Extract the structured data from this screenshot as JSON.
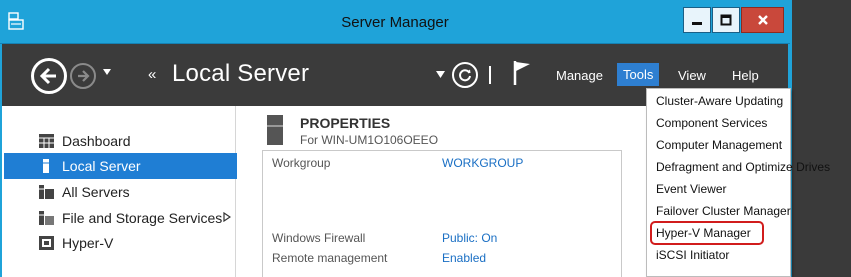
{
  "window": {
    "title": "Server Manager",
    "colors": {
      "accent": "#1fa3d9",
      "header": "#3b3b3b",
      "selection": "#1f7ed4",
      "link": "#1a6fc4",
      "highlight": "#d11c1c"
    }
  },
  "header": {
    "page_title": "Local Server",
    "menus": {
      "manage": "Manage",
      "tools": "Tools",
      "view": "View",
      "help": "Help"
    }
  },
  "sidebar": {
    "items": [
      {
        "label": "Dashboard",
        "icon": "dashboard-icon",
        "active": false
      },
      {
        "label": "Local Server",
        "icon": "local-server-icon",
        "active": true
      },
      {
        "label": "All Servers",
        "icon": "all-servers-icon",
        "active": false
      },
      {
        "label": "File and Storage Services",
        "icon": "file-storage-icon",
        "active": false,
        "has_submenu": true
      },
      {
        "label": "Hyper-V",
        "icon": "hyper-v-icon",
        "active": false
      }
    ]
  },
  "properties": {
    "title": "PROPERTIES",
    "subtitle": "For WIN-UM1O106OEEO",
    "rows": [
      {
        "key": "Workgroup",
        "value": "WORKGROUP"
      },
      {
        "key": "Windows Firewall",
        "value": "Public: On"
      },
      {
        "key": "Remote management",
        "value": "Enabled"
      }
    ]
  },
  "tools_menu": {
    "items": [
      "Cluster-Aware Updating",
      "Component Services",
      "Computer Management",
      "Defragment and Optimize Drives",
      "Event Viewer",
      "Failover Cluster Manager",
      "Hyper-V Manager",
      "iSCSI Initiator"
    ],
    "highlighted": "Hyper-V Manager"
  }
}
